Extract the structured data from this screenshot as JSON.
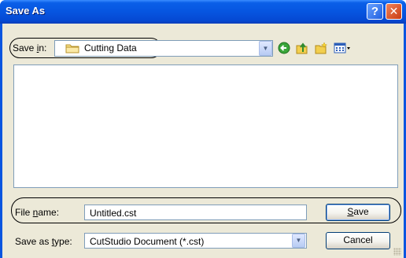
{
  "window": {
    "title": "Save As",
    "help_label": "?",
    "close_label": "✕"
  },
  "save_in": {
    "label_pre": "Save ",
    "label_u": "i",
    "label_post": "n:",
    "value": "Cutting Data",
    "icon": "folder-icon"
  },
  "toolbar": {
    "icons": [
      "back-icon",
      "up-folder-icon",
      "new-folder-icon",
      "view-menu-icon"
    ]
  },
  "file_name": {
    "label_pre": "File ",
    "label_u": "n",
    "label_post": "ame:",
    "value": "Untitled.cst"
  },
  "save_as_type": {
    "label_pre": "Save as ",
    "label_u": "t",
    "label_post": "ype:",
    "value": "CutStudio Document (*.cst)"
  },
  "buttons": {
    "save_u": "S",
    "save_rest": "ave",
    "cancel": "Cancel"
  },
  "colors": {
    "title_bar": "#0655e0",
    "dialog_bg": "#ece9d8",
    "input_border": "#7f9db9"
  }
}
